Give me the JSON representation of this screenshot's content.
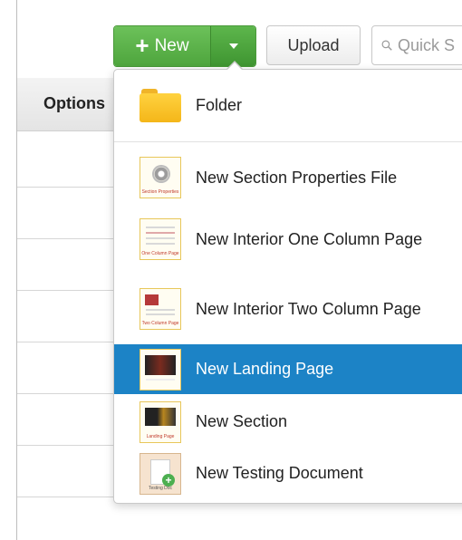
{
  "toolbar": {
    "new_label": "New",
    "upload_label": "Upload",
    "search_placeholder": "Quick S"
  },
  "table": {
    "options_header": "Options"
  },
  "menu": {
    "items": [
      {
        "label": "Folder",
        "icon": "folder-icon"
      },
      {
        "label": "New Section Properties File",
        "icon": "section-properties-thumb",
        "thumb_caption": "Section Properties"
      },
      {
        "label": "New Interior One Column Page",
        "icon": "one-column-page-thumb",
        "thumb_caption": "One Column Page"
      },
      {
        "label": "New Interior Two Column Page",
        "icon": "two-column-page-thumb",
        "thumb_caption": "Two Column Page"
      },
      {
        "label": "New Landing Page",
        "icon": "landing-page-thumb",
        "selected": true
      },
      {
        "label": "New Section",
        "icon": "landing-page-thumb",
        "thumb_caption": "Landing Page"
      },
      {
        "label": "New Testing Document",
        "icon": "testing-doc-thumb",
        "thumb_caption": "Testing Doc"
      }
    ]
  },
  "colors": {
    "new_button": "#4ea53d",
    "selected_item": "#1c83c6",
    "folder": "#f4b619"
  }
}
